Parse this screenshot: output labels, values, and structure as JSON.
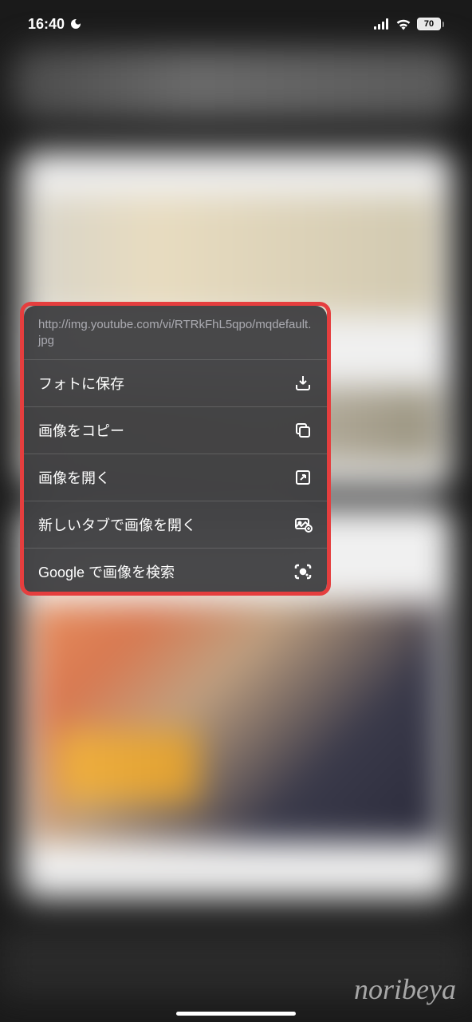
{
  "status_bar": {
    "time": "16:40",
    "battery": "70"
  },
  "context_menu": {
    "url": "http://img.youtube.com/vi/RTRkFhL5qpo/mqdefault.jpg",
    "items": [
      {
        "label": "フォトに保存",
        "icon": "download-icon"
      },
      {
        "label": "画像をコピー",
        "icon": "copy-icon"
      },
      {
        "label": "画像を開く",
        "icon": "open-external-icon"
      },
      {
        "label": "新しいタブで画像を開く",
        "icon": "image-plus-icon"
      },
      {
        "label": "Google で画像を検索",
        "icon": "lens-icon"
      }
    ]
  },
  "watermark": "noribeya"
}
